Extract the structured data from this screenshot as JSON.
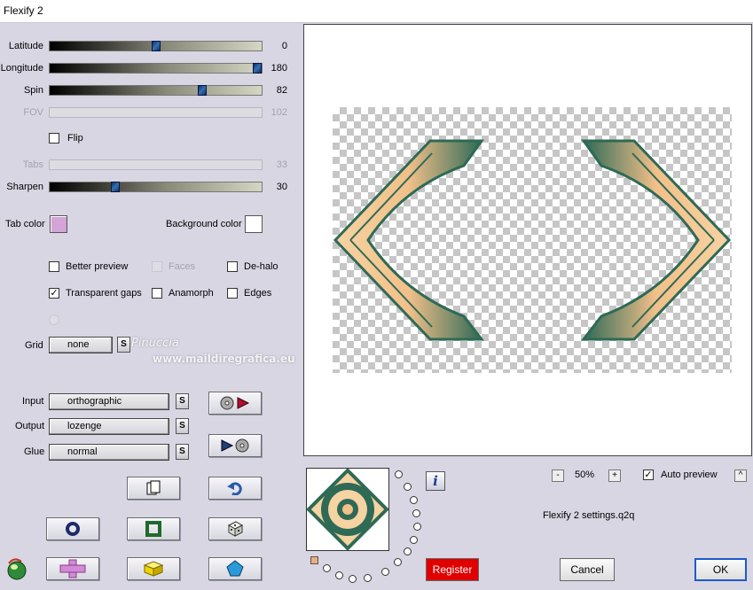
{
  "window": {
    "title": "Flexify 2"
  },
  "sliders": [
    {
      "label": "Latitude",
      "value_text": "0",
      "fraction": 0.5,
      "enabled": true
    },
    {
      "label": "Longitude",
      "value_text": "180",
      "fraction": 0.98,
      "enabled": true
    },
    {
      "label": "Spin",
      "value_text": "82",
      "fraction": 0.72,
      "enabled": true
    },
    {
      "label": "FOV",
      "value_text": "102",
      "fraction": null,
      "enabled": false
    },
    {
      "label": "Tabs",
      "value_text": "33",
      "fraction": null,
      "enabled": false
    },
    {
      "label": "Sharpen",
      "value_text": "30",
      "fraction": 0.31,
      "enabled": true
    }
  ],
  "flip": {
    "label": "Flip",
    "checked": false
  },
  "colors": {
    "tab_label": "Tab color",
    "tab_value": "#d4a4d8",
    "background_label": "Background color",
    "background_value": "#ffffff"
  },
  "options": {
    "better_preview": "Better preview",
    "faces": "Faces",
    "de_halo": "De-halo",
    "transparent_gaps": "Transparent gaps",
    "anamorph": "Anamorph",
    "edges": "Edges",
    "transparent_gaps_checked": true
  },
  "grid": {
    "label": "Grid",
    "value": "none",
    "s_label": "S"
  },
  "projection": {
    "input_label": "Input",
    "input_value": "orthographic",
    "output_label": "Output",
    "output_value": "lozenge",
    "glue_label": "Glue",
    "glue_value": "normal",
    "s_label": "S"
  },
  "watermark": {
    "name": "Pinuccia",
    "site": "www.maildiregrafica.eu"
  },
  "zoom": {
    "value": "50%",
    "minus": "-",
    "plus": "+"
  },
  "auto_preview": {
    "label": "Auto preview",
    "checked": true,
    "toggle": "^"
  },
  "settings_file": "Flexify 2 settings.q2q",
  "info_label": "i",
  "buttons": {
    "register": "Register",
    "cancel": "Cancel",
    "ok": "OK"
  },
  "theme": {
    "register_color": "#e00000",
    "shape_green": "#2e6a55",
    "shape_peach": "#f6d3a2"
  }
}
